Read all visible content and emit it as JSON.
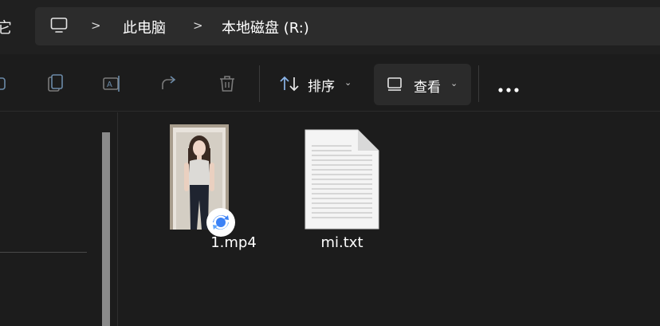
{
  "address_bar": {
    "edge_glyph": "它",
    "breadcrumbs": [
      {
        "label": "此电脑"
      },
      {
        "label": "本地磁盘 (R:)"
      }
    ],
    "separator": ">"
  },
  "toolbar": {
    "icons": [
      "rename-icon",
      "copy-icon",
      "rename-ai-icon",
      "share-icon",
      "delete-icon"
    ],
    "sort_label": "排序",
    "view_label": "查看",
    "chevron": "⌄",
    "more_icon": "more-icon"
  },
  "files": [
    {
      "name": "1.mp4",
      "type": "video",
      "badge": "sync-badge-icon"
    },
    {
      "name": "mi.txt",
      "type": "text"
    }
  ],
  "colors": {
    "background": "#1c1c1c",
    "address_box": "#2c2c2c",
    "selected_button": "#2b2b2b",
    "text": "#ffffff",
    "badge_blue": "#3b82f6"
  }
}
